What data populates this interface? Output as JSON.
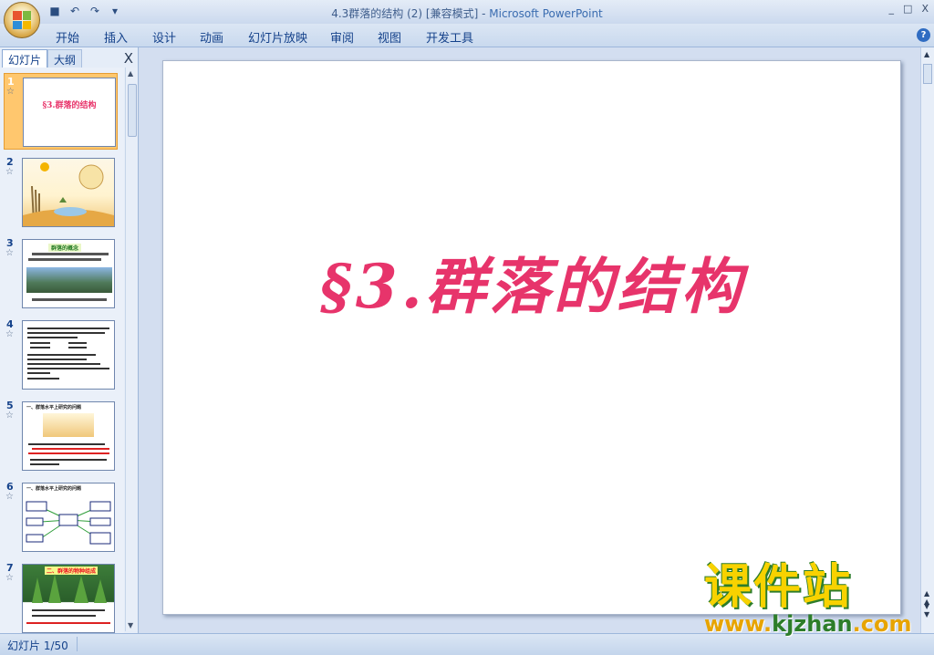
{
  "window": {
    "title": "4.3群落的结构 (2) [兼容模式]",
    "separator": " - ",
    "app_name": "Microsoft PowerPoint",
    "controls": [
      "_",
      "□",
      "X"
    ]
  },
  "quick_access": {
    "icons": [
      "save-icon",
      "undo-icon",
      "redo-icon",
      "customize-icon"
    ]
  },
  "ribbon": {
    "tabs": [
      "开始",
      "插入",
      "设计",
      "动画",
      "幻灯片放映",
      "审阅",
      "视图",
      "开发工具"
    ],
    "help": "?"
  },
  "panel": {
    "tabs": [
      "幻灯片",
      "大纲"
    ],
    "close": "X",
    "slides": [
      {
        "number": "1",
        "title": "§3.群落的结构",
        "selected": true
      },
      {
        "number": "2",
        "title": "",
        "selected": false
      },
      {
        "number": "3",
        "title": "群落的概念",
        "selected": false
      },
      {
        "number": "4",
        "title": "",
        "selected": false
      },
      {
        "number": "5",
        "title": "一、群落水平上研究的问题",
        "selected": false
      },
      {
        "number": "6",
        "title": "一、群落水平上研究的问题",
        "selected": false
      },
      {
        "number": "7",
        "title": "二、群落的物种组成",
        "selected": false
      }
    ]
  },
  "slide": {
    "title": "§3.群落的结构"
  },
  "status": {
    "slide_indicator": "幻灯片 1/50"
  },
  "watermark": {
    "big": "课件站",
    "prefix": "www.",
    "domain": "kjzhan",
    "suffix": ".com"
  },
  "colors": {
    "title_pink": "#e7346b",
    "ribbon_blue": "#15428b",
    "selection_orange": "#ffc76e"
  }
}
